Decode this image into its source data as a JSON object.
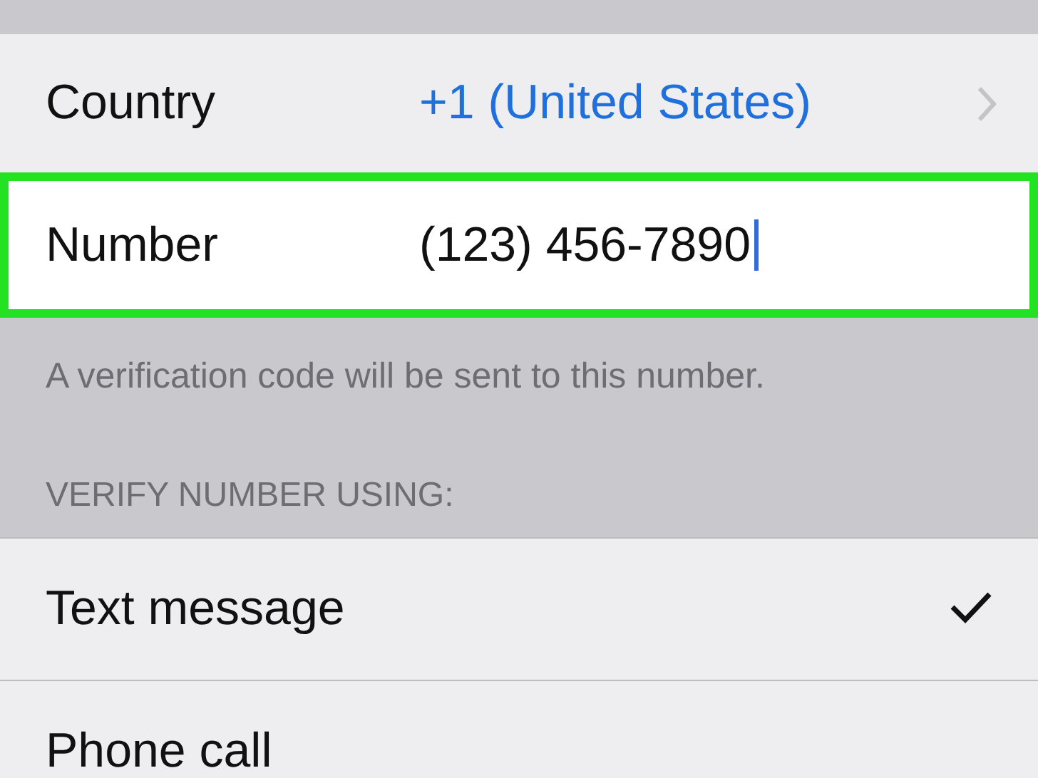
{
  "country_row": {
    "label": "Country",
    "value": "+1 (United States)"
  },
  "number_row": {
    "label": "Number",
    "value": "(123) 456-7890",
    "focused": true,
    "highlighted": true
  },
  "footer_note": "A verification code will be sent to this number.",
  "section_header": "VERIFY NUMBER USING:",
  "verify_options": [
    {
      "label": "Text message",
      "selected": true
    },
    {
      "label": "Phone call",
      "selected": false
    }
  ]
}
